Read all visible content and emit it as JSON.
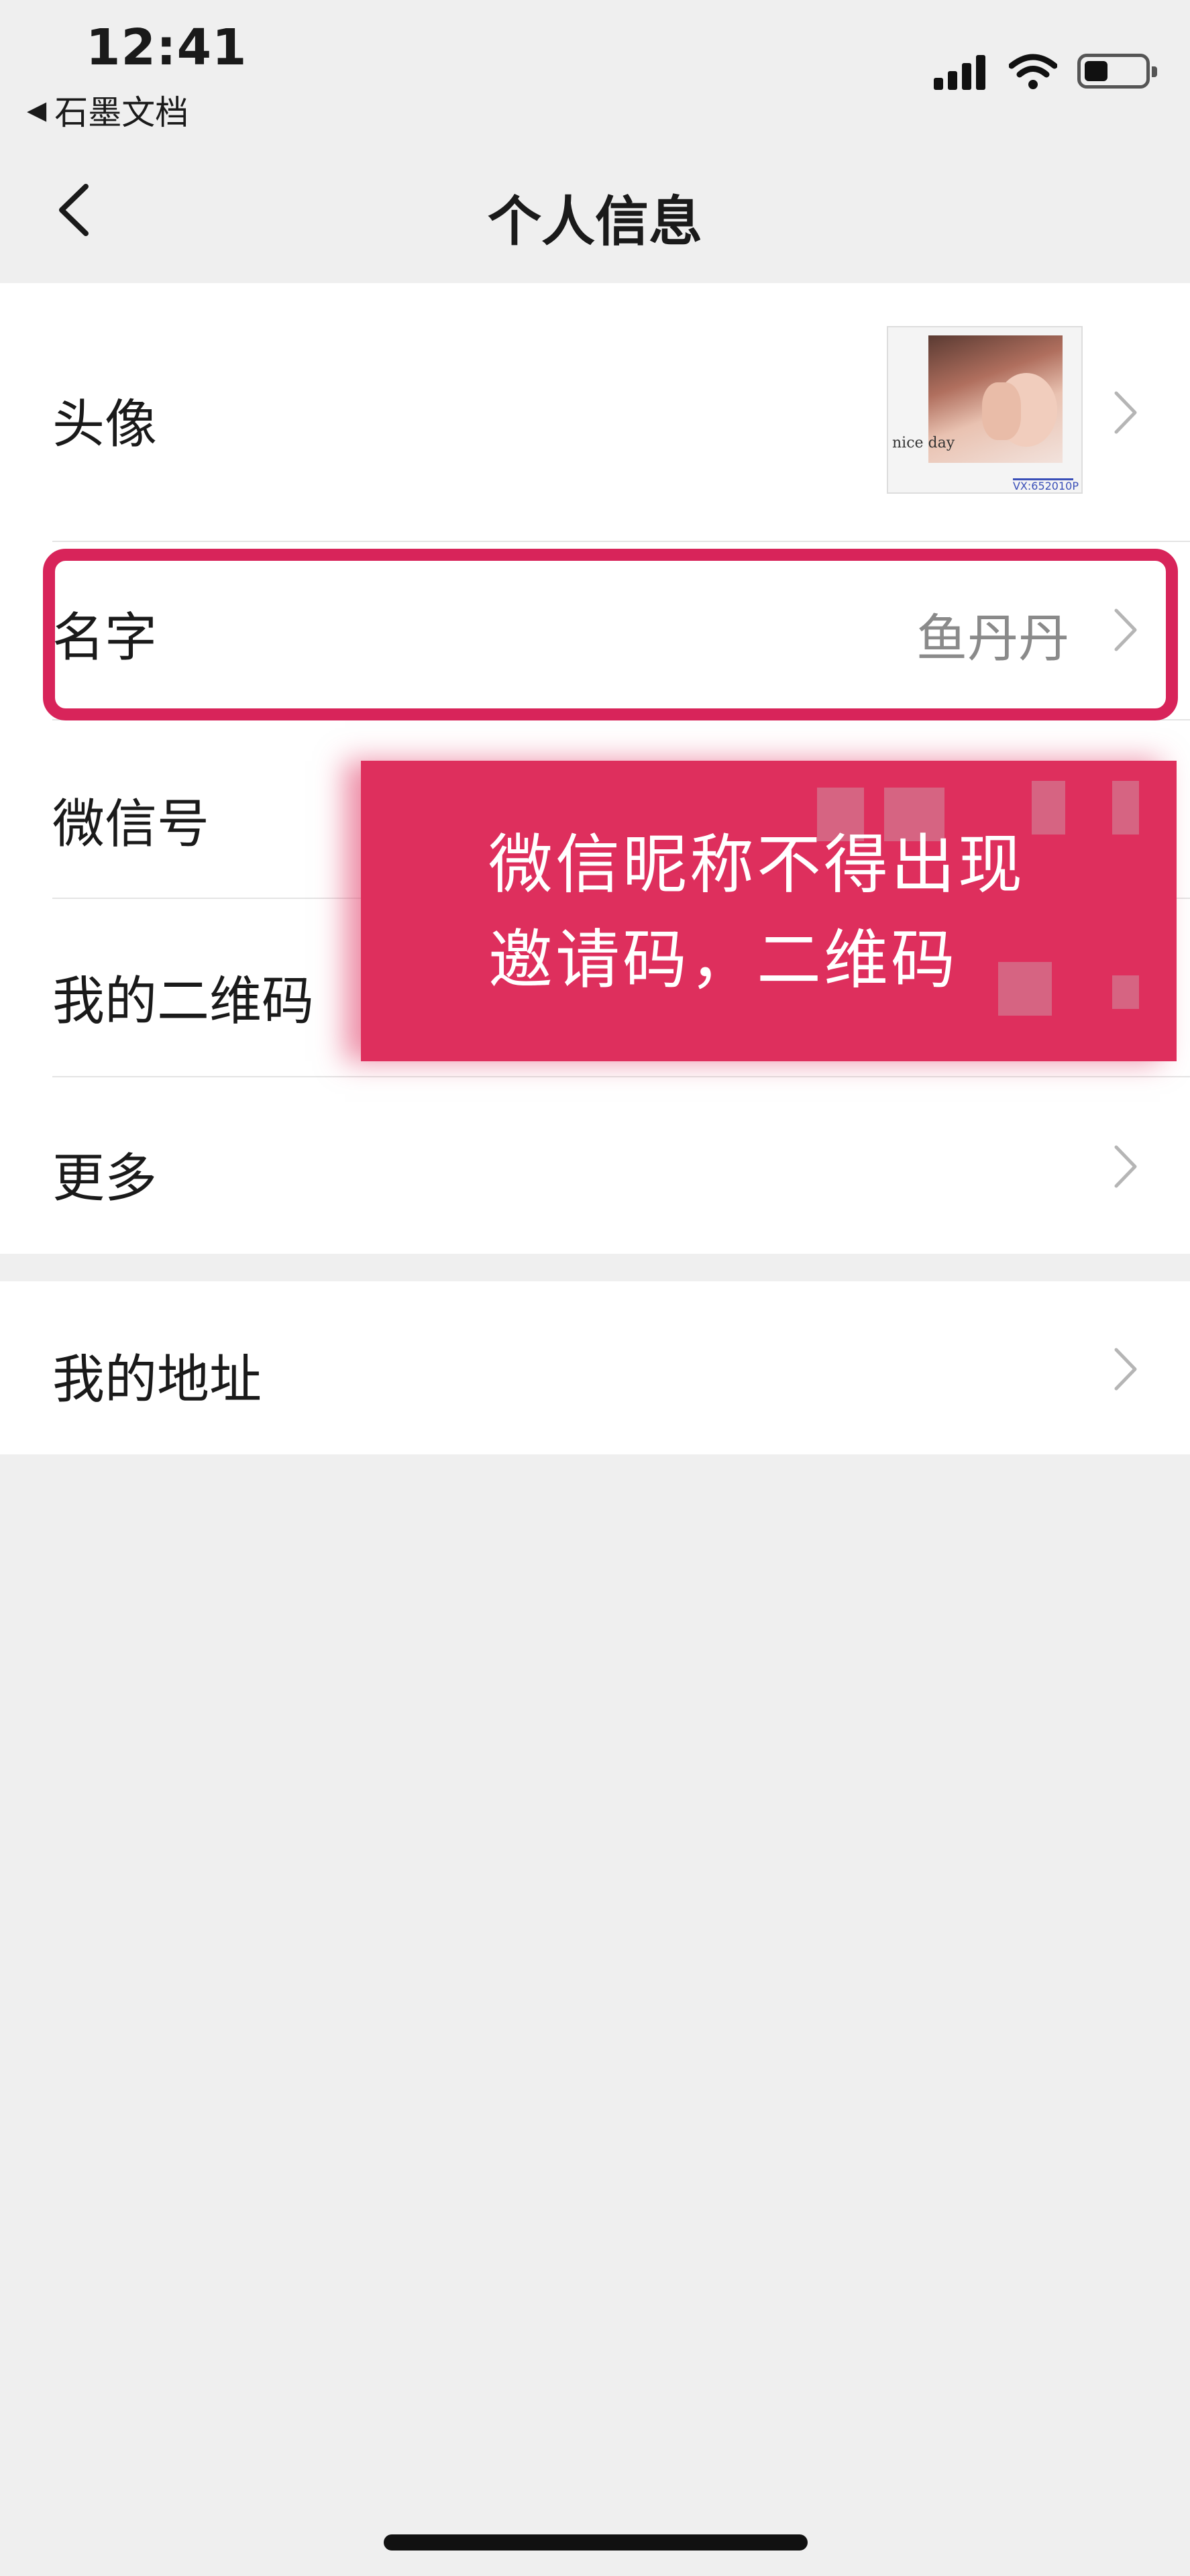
{
  "status_bar": {
    "time": "12:41",
    "back_app": "石墨文档",
    "back_glyph": "◀"
  },
  "nav": {
    "title": "个人信息"
  },
  "profile_items": {
    "avatar_label": "头像",
    "name_label": "名字",
    "name_value": "鱼丹丹",
    "wechat_id_label": "微信号",
    "qrcode_label": "我的二维码",
    "more_label": "更多"
  },
  "address": {
    "label": "我的地址"
  },
  "annotation": {
    "line1": "微信昵称不得出现",
    "line2": "邀请码，二维码",
    "color": "#de2f5d"
  },
  "avatar_image": {
    "text": "nice day",
    "watermark": "VX:652010P"
  }
}
